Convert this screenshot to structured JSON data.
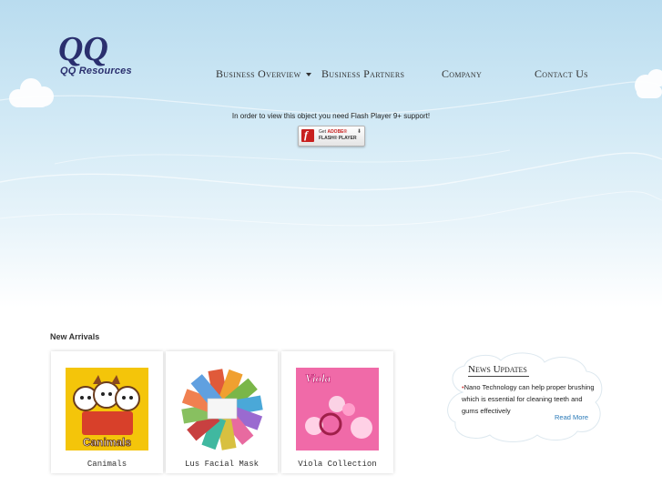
{
  "brand": {
    "logo_text": "QQ Resources",
    "logo_mark": "QQ"
  },
  "nav": {
    "items": [
      {
        "label": "Business Overview"
      },
      {
        "label": "Business Partners"
      },
      {
        "label": "Company"
      },
      {
        "label": "Contact Us"
      }
    ]
  },
  "flash": {
    "message": "In order to view this object you need Flash Player 9+ support!",
    "badge_line1_prefix": "Get ",
    "badge_line1_brand": "ADOBE®",
    "badge_line2": "FLASH® PLAYER"
  },
  "new_arrivals": {
    "title": "New Arrivals",
    "products": [
      {
        "label": "Canimals"
      },
      {
        "label": "Lus Facial Mask"
      },
      {
        "label": "Viola Collection"
      }
    ]
  },
  "news": {
    "title": "News Updates",
    "item_bullet": "•",
    "item_text": "Nano Technology can help proper brushing which is essential for cleaning teeth and gums effectively",
    "read_more": "Read More"
  },
  "product_art": {
    "canimals_word": "Canimals",
    "viola_word": "Viola"
  },
  "colors": {
    "sky_top": "#b9dcef",
    "logo_navy": "#2a2f6e",
    "link_blue": "#2a7ab8",
    "flash_red": "#c8201e",
    "canimals_yellow": "#f4c50a",
    "viola_pink": "#f06aa8"
  },
  "icons": {
    "nav_dropdown": "chevron-down-icon",
    "flash": "flash-player-icon",
    "download": "download-arrow-icon"
  }
}
